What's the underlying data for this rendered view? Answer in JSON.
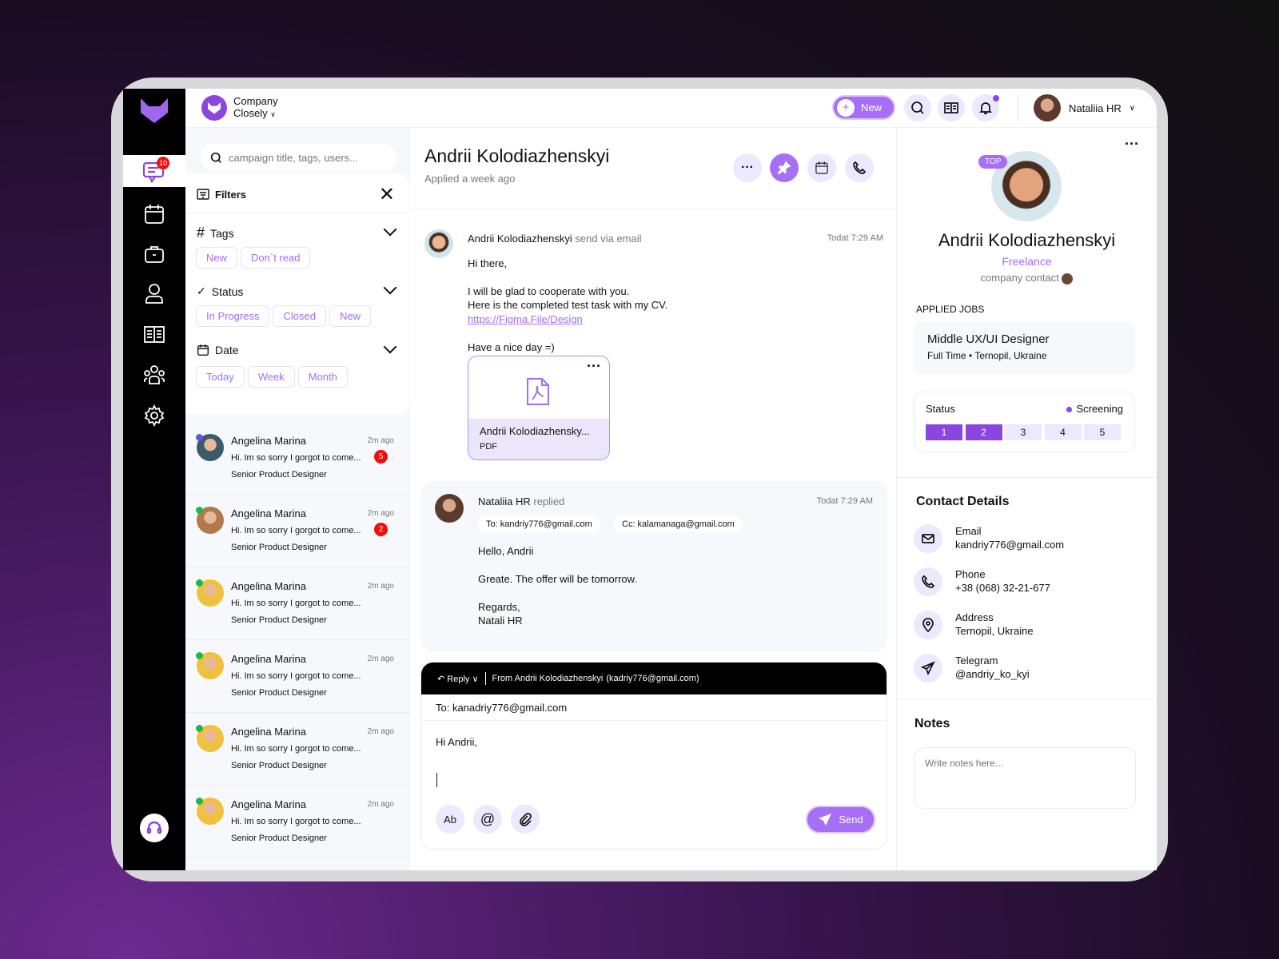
{
  "brand": {
    "company_line1": "Company",
    "company_line2": "Closely",
    "accent": "#8b45e0"
  },
  "topbar": {
    "new_label": "New",
    "user_name": "Nataliia HR"
  },
  "sidebar": {
    "chat_badge": "10",
    "icons": [
      "chat-icon",
      "calendar-icon",
      "briefcase-icon",
      "user-icon",
      "book-icon",
      "team-icon",
      "gear-icon"
    ]
  },
  "search": {
    "placeholder": "campaign title, tags, users..."
  },
  "filters": {
    "title": "Filters",
    "tags": {
      "label": "Tags",
      "chips": [
        "New",
        "Don`t read"
      ]
    },
    "status": {
      "label": "Status",
      "chips": [
        "In Progress",
        "Closed",
        "New"
      ]
    },
    "date": {
      "label": "Date",
      "chips": [
        "Today",
        "Week",
        "Month"
      ]
    }
  },
  "conversations": [
    {
      "name": "Angelina Marina",
      "time": "2m ago",
      "preview": "Hi. Im so sorry I gorgot to come...",
      "role": "Senior Product Designer",
      "unread": "5",
      "status": "#5b5bd6"
    },
    {
      "name": "Angelina Marina",
      "time": "2m ago",
      "preview": "Hi. Im so sorry I gorgot to come...",
      "role": "Senior Product Designer",
      "unread": "2",
      "status": "#1fb84a"
    },
    {
      "name": "Angelina Marina",
      "time": "2m ago",
      "preview": "Hi. Im so sorry I gorgot to come...",
      "role": "Senior Product Designer",
      "status": "#1fb84a"
    },
    {
      "name": "Angelina Marina",
      "time": "2m ago",
      "preview": "Hi. Im so sorry I gorgot to come...",
      "role": "Senior Product Designer",
      "status": "#1fb84a"
    },
    {
      "name": "Angelina Marina",
      "time": "2m ago",
      "preview": "Hi. Im so sorry I gorgot to come...",
      "role": "Senior Product Designer",
      "status": "#1fb84a"
    },
    {
      "name": "Angelina Marina",
      "time": "2m ago",
      "preview": "Hi. Im so sorry I gorgot to come...",
      "role": "Senior Product Designer",
      "status": "#1fb84a"
    }
  ],
  "thread": {
    "title": "Andrii Kolodiazhenskyi",
    "subtitle": "Applied a week ago",
    "msg1": {
      "sender": "Andrii Kolodiazhenskyi",
      "action": "send via email",
      "time": "Todat 7:29 AM",
      "greeting": "Hi there,",
      "line1": "I will be glad to cooperate with you.",
      "line2": "Here is the completed test task with my CV.",
      "link": "https://Figma.File/Design",
      "closing": "Have a nice day =)",
      "attachment": {
        "name": "Andrii Kolodiazhensky...",
        "type": "PDF"
      }
    },
    "msg2": {
      "sender": "Nataliia HR",
      "action": "replied",
      "time": "Todat 7:29 AM",
      "to": "To: kandriy776@gmail.com",
      "cc": "Cc: kalamanaga@gmail.com",
      "l1": "Hello, Andrii",
      "l2": "Greate. The offer will be tomorrow.",
      "l3": "Regards,",
      "l4": "Natali HR"
    }
  },
  "composer": {
    "reply_label": "Reply",
    "from_bold": "From Andrii Kolodiazhenskyi",
    "from_email": "(kadriy776@gmail.com)",
    "to": "To: kanadriy776@gmail.com",
    "body": "Hi Andrii,",
    "format_label": "Ab",
    "mention_label": "@",
    "send_label": "Send"
  },
  "profile": {
    "badge": "TOP",
    "name": "Andrii Kolodiazhenskyi",
    "type": "Freelance",
    "contact_label": "company contact",
    "applied_jobs_label": "APPLIED JOBS",
    "job_title": "Middle UX/UI Designer",
    "job_meta": "Full Time • Ternopil, Ukraine",
    "status_label": "Status",
    "status_value": "Screening",
    "steps": [
      "1",
      "2",
      "3",
      "4",
      "5"
    ],
    "steps_completed": 2
  },
  "contact": {
    "title": "Contact Details",
    "items": [
      {
        "label": "Email",
        "value": "kandriy776@gmail.com",
        "icon": "mail-icon"
      },
      {
        "label": "Phone",
        "value": "+38 (068) 32-21-677",
        "icon": "phone-icon"
      },
      {
        "label": "Address",
        "value": "Ternopil, Ukraine",
        "icon": "location-icon"
      },
      {
        "label": "Telegram",
        "value": "@andriy_ko_kyi",
        "icon": "telegram-icon"
      }
    ]
  },
  "notes": {
    "title": "Notes",
    "placeholder": "Write notes here..."
  }
}
